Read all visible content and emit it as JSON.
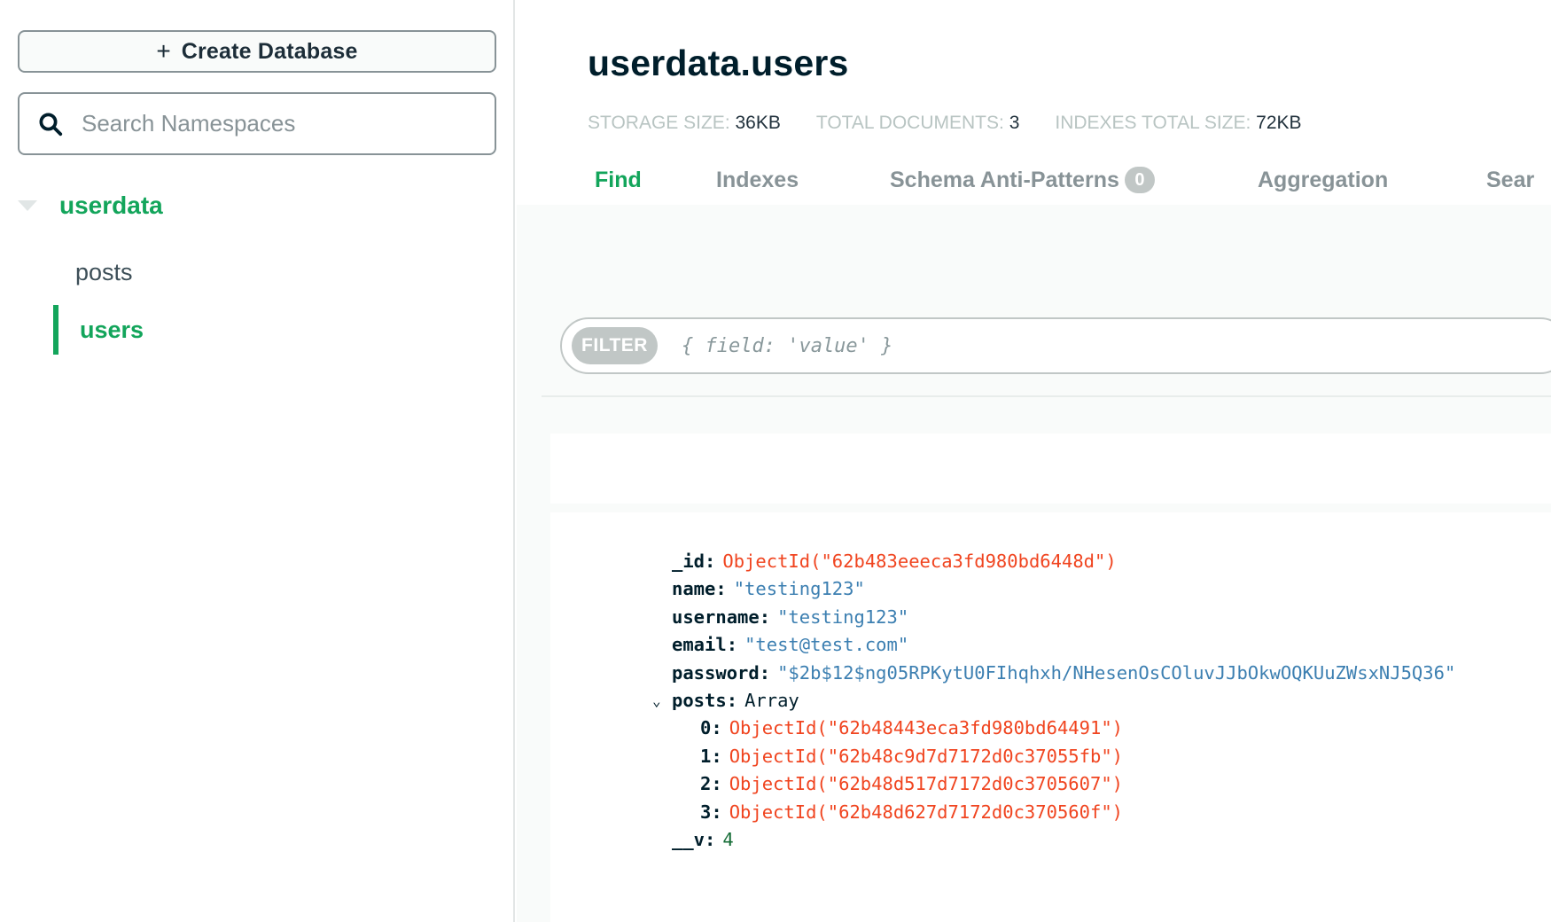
{
  "sidebar": {
    "create_button": {
      "icon": "plus-icon",
      "label": "Create Database"
    },
    "search": {
      "icon": "search-icon",
      "placeholder": "Search Namespaces",
      "value": ""
    },
    "databases": [
      {
        "name": "userdata",
        "expanded": true,
        "collections": [
          {
            "name": "posts",
            "active": false
          },
          {
            "name": "users",
            "active": true
          }
        ]
      }
    ]
  },
  "header": {
    "title": "userdata.users",
    "stats": [
      {
        "label": "STORAGE SIZE:",
        "value": "36KB"
      },
      {
        "label": "TOTAL DOCUMENTS:",
        "value": "3"
      },
      {
        "label": "INDEXES TOTAL SIZE:",
        "value": "72KB"
      }
    ],
    "tabs": [
      {
        "label": "Find",
        "active": true
      },
      {
        "label": "Indexes",
        "active": false
      },
      {
        "label": "Schema Anti-Patterns",
        "badge": "0",
        "active": false
      },
      {
        "label": "Aggregation",
        "active": false
      },
      {
        "label": "Sear",
        "active": false
      }
    ]
  },
  "filter": {
    "label": "FILTER",
    "placeholder": "{ field: 'value' }",
    "value": ""
  },
  "document": {
    "fields": [
      {
        "key": "_id:",
        "value": "ObjectId(\"62b483eeeca3fd980bd6448d\")",
        "type": "oid"
      },
      {
        "key": "name:",
        "value": "\"testing123\"",
        "type": "str"
      },
      {
        "key": "username:",
        "value": "\"testing123\"",
        "type": "str"
      },
      {
        "key": "email:",
        "value": "\"test@test.com\"",
        "type": "str"
      },
      {
        "key": "password:",
        "value": "\"$2b$12$ng05RPKytU0FIhqhxh/NHesenOsCOluvJJbOkwOQKUuZWsxNJ5Q36\"",
        "type": "str"
      },
      {
        "key": "posts:",
        "value": "Array",
        "type": "array",
        "expanded": true
      },
      {
        "key": "0:",
        "value": "ObjectId(\"62b48443eca3fd980bd64491\")",
        "type": "oid"
      },
      {
        "key": "1:",
        "value": "ObjectId(\"62b48c9d7d7172d0c37055fb\")",
        "type": "oid"
      },
      {
        "key": "2:",
        "value": "ObjectId(\"62b48d517d7172d0c3705607\")",
        "type": "oid"
      },
      {
        "key": "3:",
        "value": "ObjectId(\"62b48d627d7172d0c370560f\")",
        "type": "oid"
      },
      {
        "key": "__v:",
        "value": "4",
        "type": "num"
      }
    ]
  },
  "colors": {
    "accent_green": "#13a55b",
    "objectid_red": "#f0441f",
    "string_blue": "#3c7fb1",
    "number_green": "#166d37",
    "muted_gray": "#889397"
  }
}
